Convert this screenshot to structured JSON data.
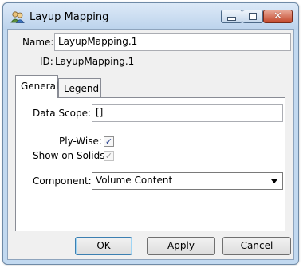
{
  "window": {
    "title": "Layup Mapping",
    "controls": {
      "minimize_icon": "minimize-icon",
      "maximize_icon": "maximize-icon",
      "close_icon": "close-icon"
    }
  },
  "header": {
    "name_label": "Name:",
    "name_value": "LayupMapping.1",
    "id_label": "ID:",
    "id_value": "LayupMapping.1"
  },
  "tabs": [
    {
      "label": "General",
      "active": true
    },
    {
      "label": "Legend",
      "active": false
    }
  ],
  "general": {
    "data_scope_label": "Data Scope:",
    "data_scope_value": "[]",
    "ply_wise_label": "Ply-Wise:",
    "ply_wise_checked": true,
    "show_on_solids_label": "Show on Solids:",
    "show_on_solids_checked": true,
    "show_on_solids_enabled": false,
    "component_label": "Component:",
    "component_value": "Volume Content"
  },
  "buttons": {
    "ok": "OK",
    "apply": "Apply",
    "cancel": "Cancel"
  }
}
